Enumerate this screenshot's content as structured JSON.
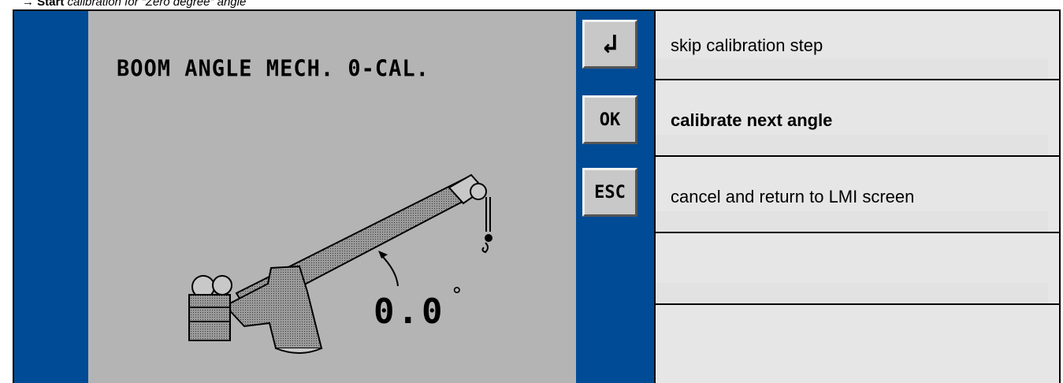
{
  "caption": {
    "arrow": "→",
    "bold": "Start",
    "text": " calibration for “Zero degree” angle"
  },
  "lcd": {
    "title": "BOOM ANGLE MECH. 0-CAL.",
    "angle_value": "0.0",
    "angle_unit": "°"
  },
  "keys": {
    "enter_label": "↲",
    "ok_label": "OK",
    "esc_label": "ESC"
  },
  "descriptions": [
    "skip calibration step",
    "calibrate next angle",
    "cancel and return to LMI screen",
    "",
    ""
  ],
  "colors": {
    "lcd_background": "#b4b4b4",
    "side_band": "#004b96",
    "cell_background": "#e6e6e6"
  }
}
